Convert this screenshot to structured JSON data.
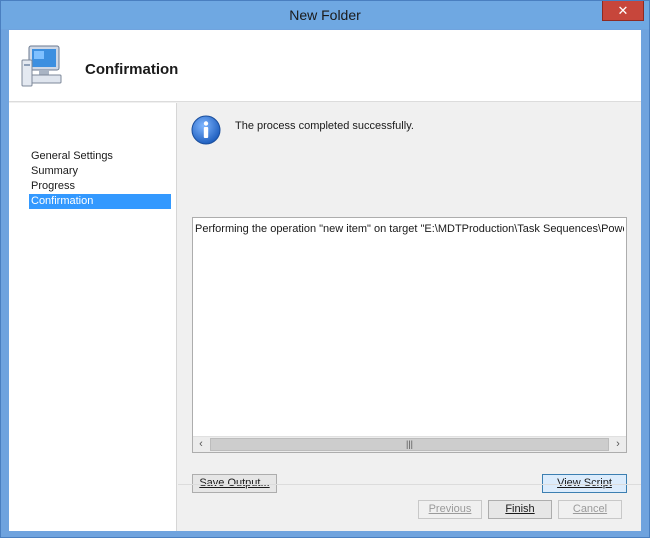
{
  "window": {
    "title": "New Folder",
    "close_label": "✕"
  },
  "header": {
    "title": "Confirmation",
    "icon": "computer-wizard-icon"
  },
  "sidebar": {
    "items": [
      {
        "label": "General Settings",
        "selected": false
      },
      {
        "label": "Summary",
        "selected": false
      },
      {
        "label": "Progress",
        "selected": false
      },
      {
        "label": "Confirmation",
        "selected": true
      }
    ]
  },
  "main": {
    "info_icon": "info-icon",
    "message": "The process completed successfully.",
    "output_text": "Performing the operation \"new item\" on target \"E:\\MDTProduction\\Task Sequences\\PowerShell Demo",
    "save_output_label": "Save Output...",
    "view_script_label": "View Script"
  },
  "footer": {
    "previous_label": "Previous",
    "finish_label": "Finish",
    "cancel_label": "Cancel"
  },
  "colors": {
    "selection": "#3399ff",
    "title_bar": "#6fa8e2",
    "close_button": "#c7463b"
  }
}
